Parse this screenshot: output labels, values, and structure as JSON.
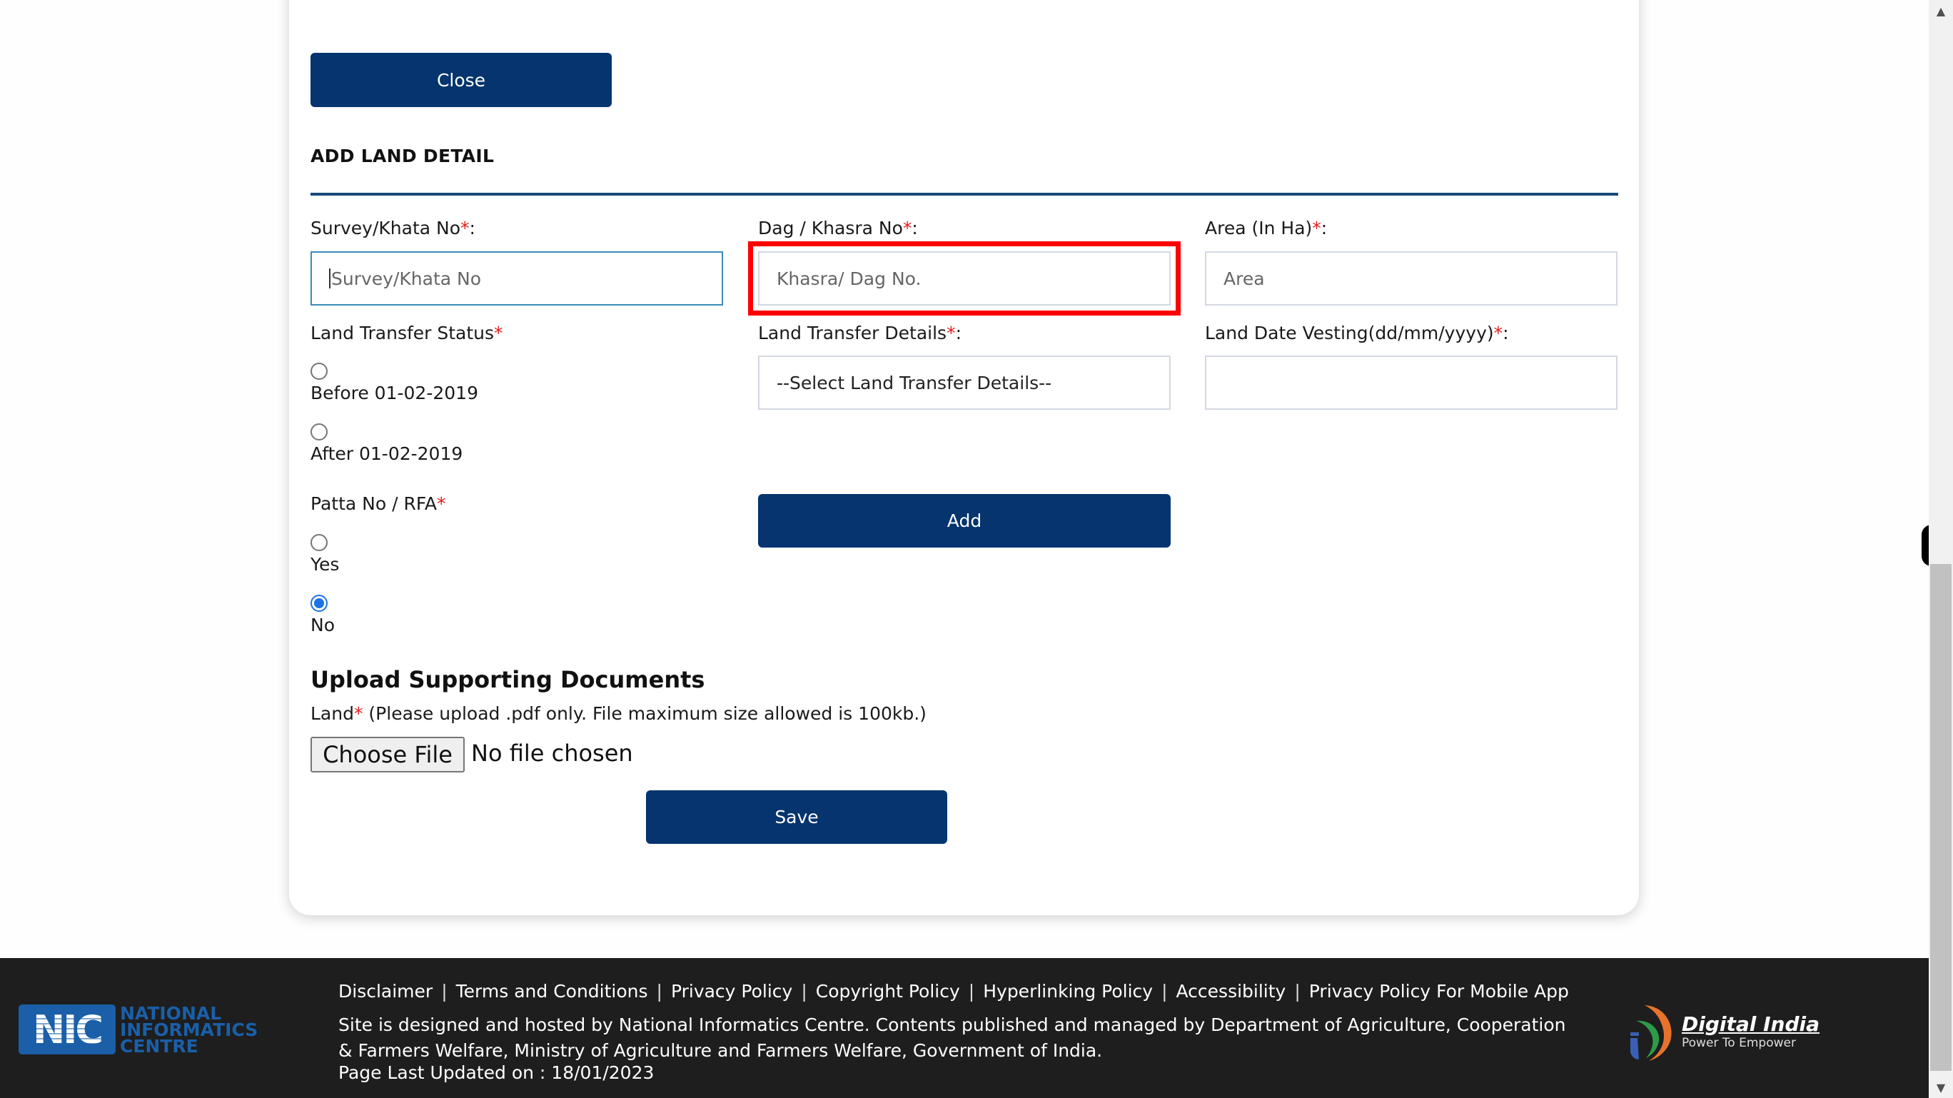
{
  "form": {
    "close_label": "Close",
    "section_title": "ADD LAND DETAIL",
    "fields": {
      "survey": {
        "label": "Survey/Khata No",
        "required_mark": "*",
        "suffix": ":",
        "placeholder": "Survey/Khata No",
        "value": ""
      },
      "dag": {
        "label": "Dag / Khasra No",
        "required_mark": "*",
        "suffix": ":",
        "placeholder": "Khasra/ Dag No.",
        "value": ""
      },
      "area": {
        "label": "Area (In Ha)",
        "required_mark": "*",
        "suffix": ":",
        "placeholder": "Area",
        "value": ""
      },
      "transfer_status": {
        "label": "Land Transfer Status",
        "required_mark": "*",
        "options": [
          {
            "label": "Before 01-02-2019",
            "checked": false
          },
          {
            "label": "After 01-02-2019",
            "checked": false
          }
        ]
      },
      "transfer_details": {
        "label": "Land Transfer Details",
        "required_mark": "*",
        "suffix": ":",
        "selected": "--Select Land Transfer Details--"
      },
      "date_vesting": {
        "label": "Land Date Vesting(dd/mm/yyyy)",
        "required_mark": "*",
        "suffix": ":",
        "value": ""
      },
      "patta": {
        "label": "Patta No / RFA",
        "required_mark": "*",
        "options": [
          {
            "label": "Yes",
            "checked": false
          },
          {
            "label": "No",
            "checked": true
          }
        ]
      }
    },
    "add_label": "Add",
    "upload": {
      "heading": "Upload Supporting Documents",
      "land_label": "Land",
      "required_mark": "*",
      "note": " (Please upload .pdf only. File maximum size allowed is 100kb.)",
      "choose_file_label": "Choose File",
      "no_file_text": "No file chosen"
    },
    "save_label": "Save"
  },
  "footer": {
    "links": [
      "Disclaimer",
      "Terms and Conditions",
      "Privacy Policy",
      "Copyright Policy",
      "Hyperlinking Policy",
      "Accessibility",
      "Privacy Policy For Mobile App"
    ],
    "separator": "|",
    "site_text": "Site is designed and hosted by National Informatics Centre. Contents published and managed by Department of Agriculture, Cooperation & Farmers Welfare, Ministry of Agriculture and Farmers Welfare, Government of India.",
    "updated_text": "Page Last Updated on : 18/01/2023",
    "nic_logo": {
      "mark": "NIC",
      "line1": "NATIONAL",
      "line2": "INFORMATICS",
      "line3": "CENTRE"
    },
    "digital_india_logo": {
      "title": "Digital India",
      "tagline": "Power To Empower"
    }
  },
  "colors": {
    "primary_button": "#05346e",
    "rule": "#17497a",
    "required": "#e41b1b",
    "highlight": "#ff0000",
    "footer_bg": "#1e1e1e",
    "radio_checked": "#1a73e8"
  }
}
